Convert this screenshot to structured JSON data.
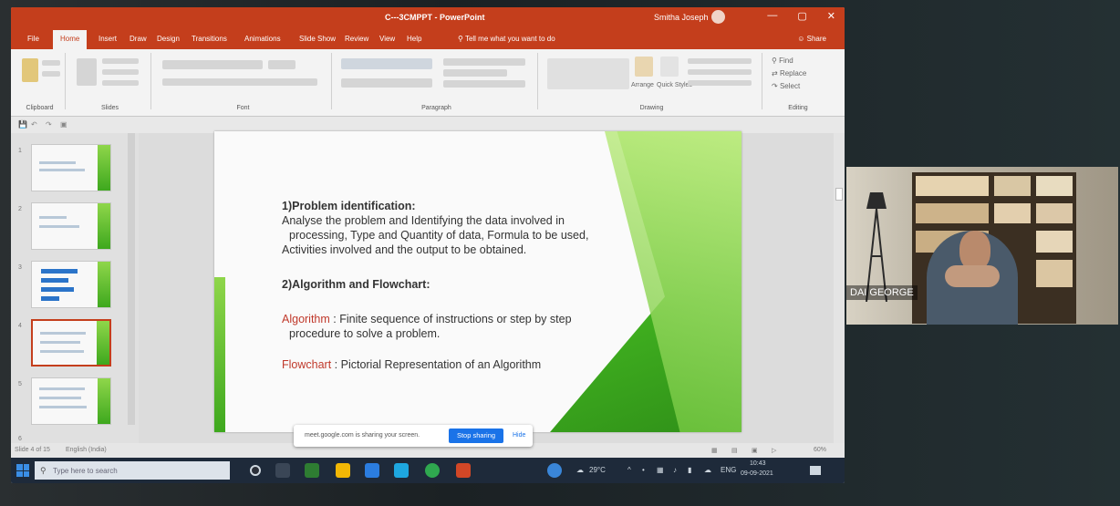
{
  "window": {
    "title": "C---3CMPPT - PowerPoint",
    "user": "Smitha Joseph",
    "controls": [
      "—",
      "▢",
      "✕"
    ]
  },
  "ribbon": {
    "tabs": [
      "File",
      "Home",
      "Insert",
      "Draw",
      "Design",
      "Transitions",
      "Animations",
      "Slide Show",
      "Review",
      "View",
      "Help"
    ],
    "active_tab": "Home",
    "tell_me": "Tell me what you want to do",
    "share": "Share",
    "groups": [
      "Clipboard",
      "Slides",
      "Font",
      "Paragraph",
      "Drawing",
      "Editing"
    ],
    "drawing_buttons": [
      "Arrange",
      "Quick Styles"
    ],
    "editing_buttons": [
      "Find",
      "Replace",
      "Select"
    ]
  },
  "slides": {
    "thumbnail_numbers": [
      "1",
      "2",
      "3",
      "4",
      "5",
      "6"
    ],
    "selected_index": 4
  },
  "slide": {
    "heading1": "1)Problem identification:",
    "para1_line1": "Analyse the problem and Identifying the data involved in",
    "para1_line2": "processing, Type and Quantity of data, Formula to be used,",
    "para1_line3": "Activities involved and the output to be obtained.",
    "heading2": "2)Algorithm and Flowchart:",
    "algo_term": "Algorithm",
    "algo_def1": " : Finite sequence of instructions or step by step",
    "algo_def2": "procedure to solve a problem.",
    "flow_term": "Flowchart",
    "flow_def": " : Pictorial Representation of an Algorithm"
  },
  "statusbar": {
    "slide_info": "Slide 4 of 15",
    "language": "English (India)",
    "zoom": "60%"
  },
  "sharebar": {
    "message": "meet.google.com is sharing your screen.",
    "stop": "Stop sharing",
    "hide": "Hide"
  },
  "taskbar": {
    "search_placeholder": "Type here to search",
    "weather": "29°C",
    "lang": "ENG",
    "time": "10:43",
    "date": "09-09-2021"
  },
  "video": {
    "participant": "DAI GEORGE"
  },
  "colors": {
    "ppt_accent": "#c43e1c",
    "slide_green": "#3fae1f",
    "term_red": "#c0392b"
  }
}
